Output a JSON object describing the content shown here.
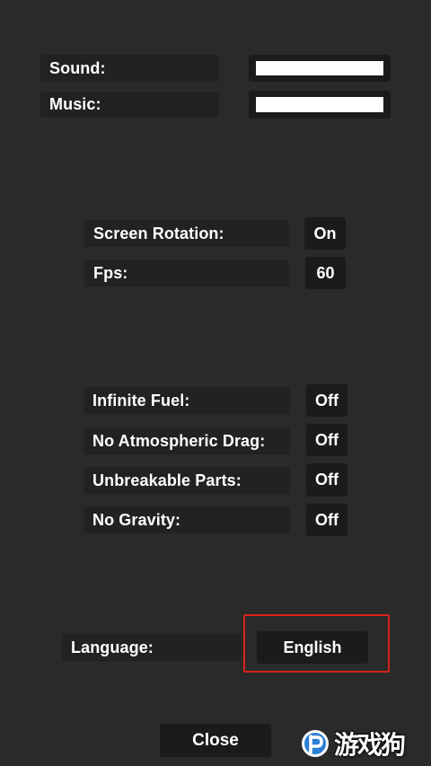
{
  "audio": {
    "sound_label": "Sound:",
    "sound_level": 1.0,
    "music_label": "Music:",
    "music_level": 1.0
  },
  "display": {
    "rotation_label": "Screen Rotation:",
    "rotation_value": "On",
    "fps_label": "Fps:",
    "fps_value": "60"
  },
  "cheats": {
    "fuel_label": "Infinite Fuel:",
    "fuel_value": "Off",
    "drag_label": "No Atmospheric Drag:",
    "drag_value": "Off",
    "parts_label": "Unbreakable Parts:",
    "parts_value": "Off",
    "gravity_label": "No Gravity:",
    "gravity_value": "Off"
  },
  "language": {
    "label": "Language:",
    "value": "English",
    "highlight_color": "#d8231b"
  },
  "footer": {
    "close_label": "Close"
  },
  "watermark": {
    "text": "游戏狗",
    "icon": "watermark-logo-icon",
    "accent_color": "#2a7fd4"
  }
}
